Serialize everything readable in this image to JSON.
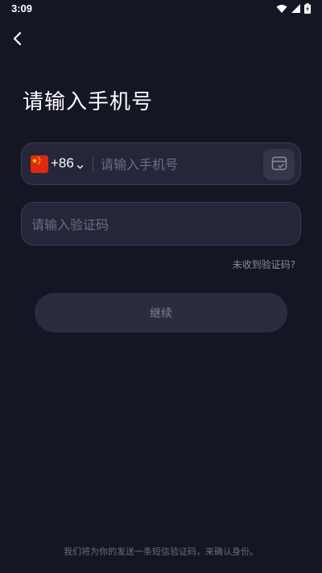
{
  "status_bar": {
    "time": "3:09",
    "icons": [
      "wifi-icon",
      "signal-icon",
      "battery-charging-icon"
    ]
  },
  "header": {
    "back_icon": "chevron-left-icon"
  },
  "page": {
    "title": "请输入手机号"
  },
  "phone_field": {
    "country_flag": "china-flag-icon",
    "country_code": "+86",
    "placeholder": "请输入手机号",
    "value": "",
    "sim_icon": "sim-card-icon"
  },
  "code_field": {
    "placeholder": "请输入验证码",
    "value": ""
  },
  "no_code_link": "未收到验证码?",
  "continue_button": "继续",
  "footer_note": "我们将为你的发送一条短信验证码，来确认身份。",
  "colors": {
    "background": "#151624",
    "field_bg": "#25263a",
    "field_border": "#3a3b52",
    "button_bg": "#2b2c40",
    "button_text": "#7e7f92",
    "placeholder": "#6c6d82",
    "flag_red": "#de2910",
    "flag_yellow": "#ffde00"
  }
}
